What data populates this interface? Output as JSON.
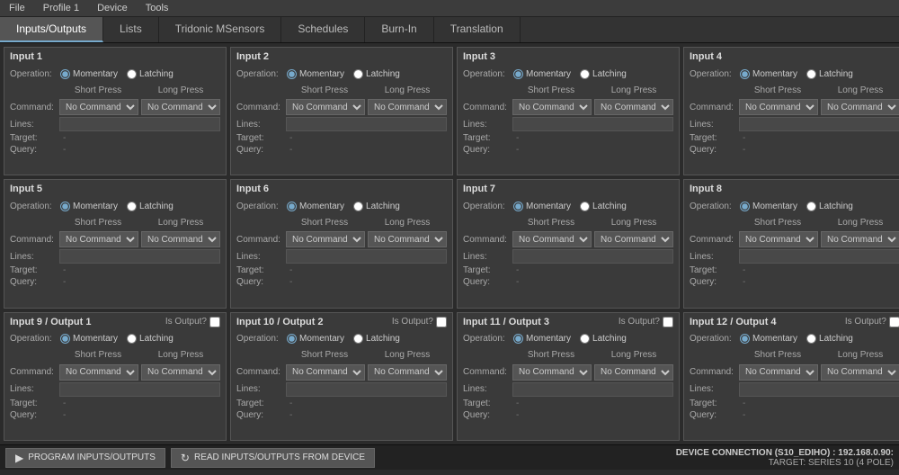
{
  "menubar": {
    "items": [
      "File",
      "Profile 1",
      "Device",
      "Tools"
    ]
  },
  "tabs": [
    {
      "label": "Inputs/Outputs",
      "active": true
    },
    {
      "label": "Lists",
      "active": false
    },
    {
      "label": "Tridonic MSensors",
      "active": false
    },
    {
      "label": "Schedules",
      "active": false
    },
    {
      "label": "Burn-In",
      "active": false
    },
    {
      "label": "Translation",
      "active": false
    }
  ],
  "inputs": [
    {
      "id": 1,
      "title": "Input 1",
      "is_output": false
    },
    {
      "id": 2,
      "title": "Input 2",
      "is_output": false
    },
    {
      "id": 3,
      "title": "Input 3",
      "is_output": false
    },
    {
      "id": 4,
      "title": "Input 4",
      "is_output": false
    },
    {
      "id": 5,
      "title": "Input 5",
      "is_output": false
    },
    {
      "id": 6,
      "title": "Input 6",
      "is_output": false
    },
    {
      "id": 7,
      "title": "Input 7",
      "is_output": false
    },
    {
      "id": 8,
      "title": "Input 8",
      "is_output": false
    },
    {
      "id": 9,
      "title": "Input 9 / Output 1",
      "is_output": true
    },
    {
      "id": 10,
      "title": "Input 10 / Output 2",
      "is_output": true
    },
    {
      "id": 11,
      "title": "Input 11 / Output 3",
      "is_output": true
    },
    {
      "id": 12,
      "title": "Input 12 / Output 4",
      "is_output": true
    }
  ],
  "labels": {
    "operation": "Operation:",
    "momentary": "Momentary",
    "latching": "Latching",
    "short_press": "Short Press",
    "long_press": "Long Press",
    "command": "Command:",
    "lines": "Lines:",
    "target": "Target:",
    "query": "Query:",
    "no_command": "No Command",
    "is_output": "Is Output?",
    "program_btn": "PROGRAM INPUTS/OUTPUTS",
    "read_btn": "READ INPUTS/OUTPUTS FROM DEVICE",
    "dash": "-"
  },
  "connection": {
    "title": "DEVICE CONNECTION (S10_EDIHO) : 192.168.0.90:",
    "target": "TARGET: SERIES 10 (4 POLE)"
  },
  "bottom": {
    "program_label": "PROGRAM INPUTS/OUTPUTS",
    "read_label": "READ INPUTS/OUTPUTS FROM DEVICE"
  }
}
